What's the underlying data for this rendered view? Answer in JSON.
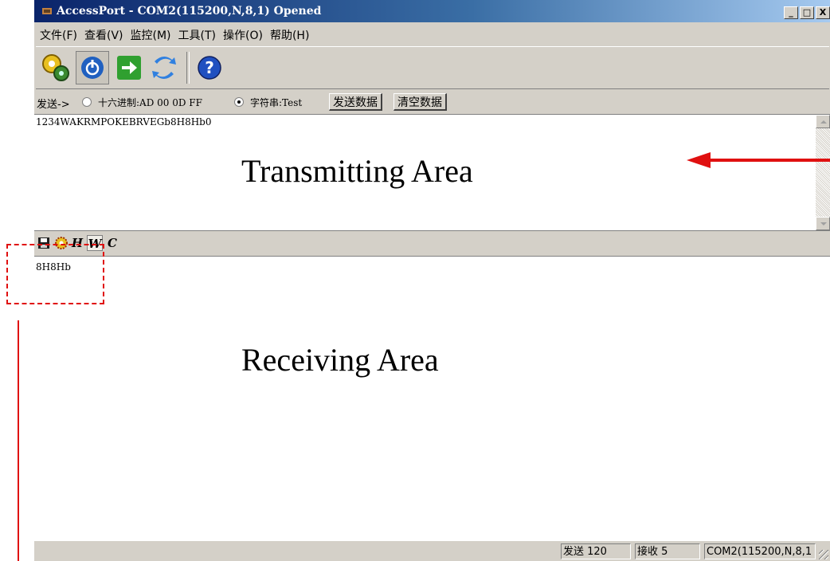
{
  "window": {
    "title": "AccessPort - COM2(115200,N,8,1) Opened",
    "caption_buttons": {
      "minimize": "_",
      "maximize": "□",
      "close": "X"
    }
  },
  "menu": [
    "文件(F)",
    "查看(V)",
    "监控(M)",
    "工具(T)",
    "操作(O)",
    "帮助(H)"
  ],
  "toolbar": {
    "icons": [
      "gears-icon",
      "power-icon",
      "go-arrow-icon",
      "refresh-icon",
      "help-icon"
    ]
  },
  "send_bar": {
    "label": "发送->",
    "hex_option": "十六进制:AD 00 0D FF",
    "string_option": "字符串:Test",
    "selected": "string",
    "send_button": "发送数据",
    "clear_button": "清空数据"
  },
  "transmit": {
    "text": "1234WAKRMPOKEBRVEGb8H8Hb0",
    "annotation": "Transmitting Area"
  },
  "receive_toolbar": {
    "buttons": [
      {
        "icon": "save-icon",
        "label": ""
      },
      {
        "icon": "gear-icon",
        "label": ""
      },
      {
        "icon": "h-icon",
        "label": "H"
      },
      {
        "icon": "w-icon",
        "label": "W"
      },
      {
        "icon": "c-icon",
        "label": "C"
      }
    ]
  },
  "receive": {
    "text": "8H8Hb",
    "annotation": "Receiving Area"
  },
  "status": {
    "sent": "发送 120",
    "received": "接收 5",
    "port": "COM2(115200,N,8,1"
  },
  "colors": {
    "annotation_red": "#e01010",
    "title_bar": "#0a246a",
    "face": "#d4d0c8"
  }
}
